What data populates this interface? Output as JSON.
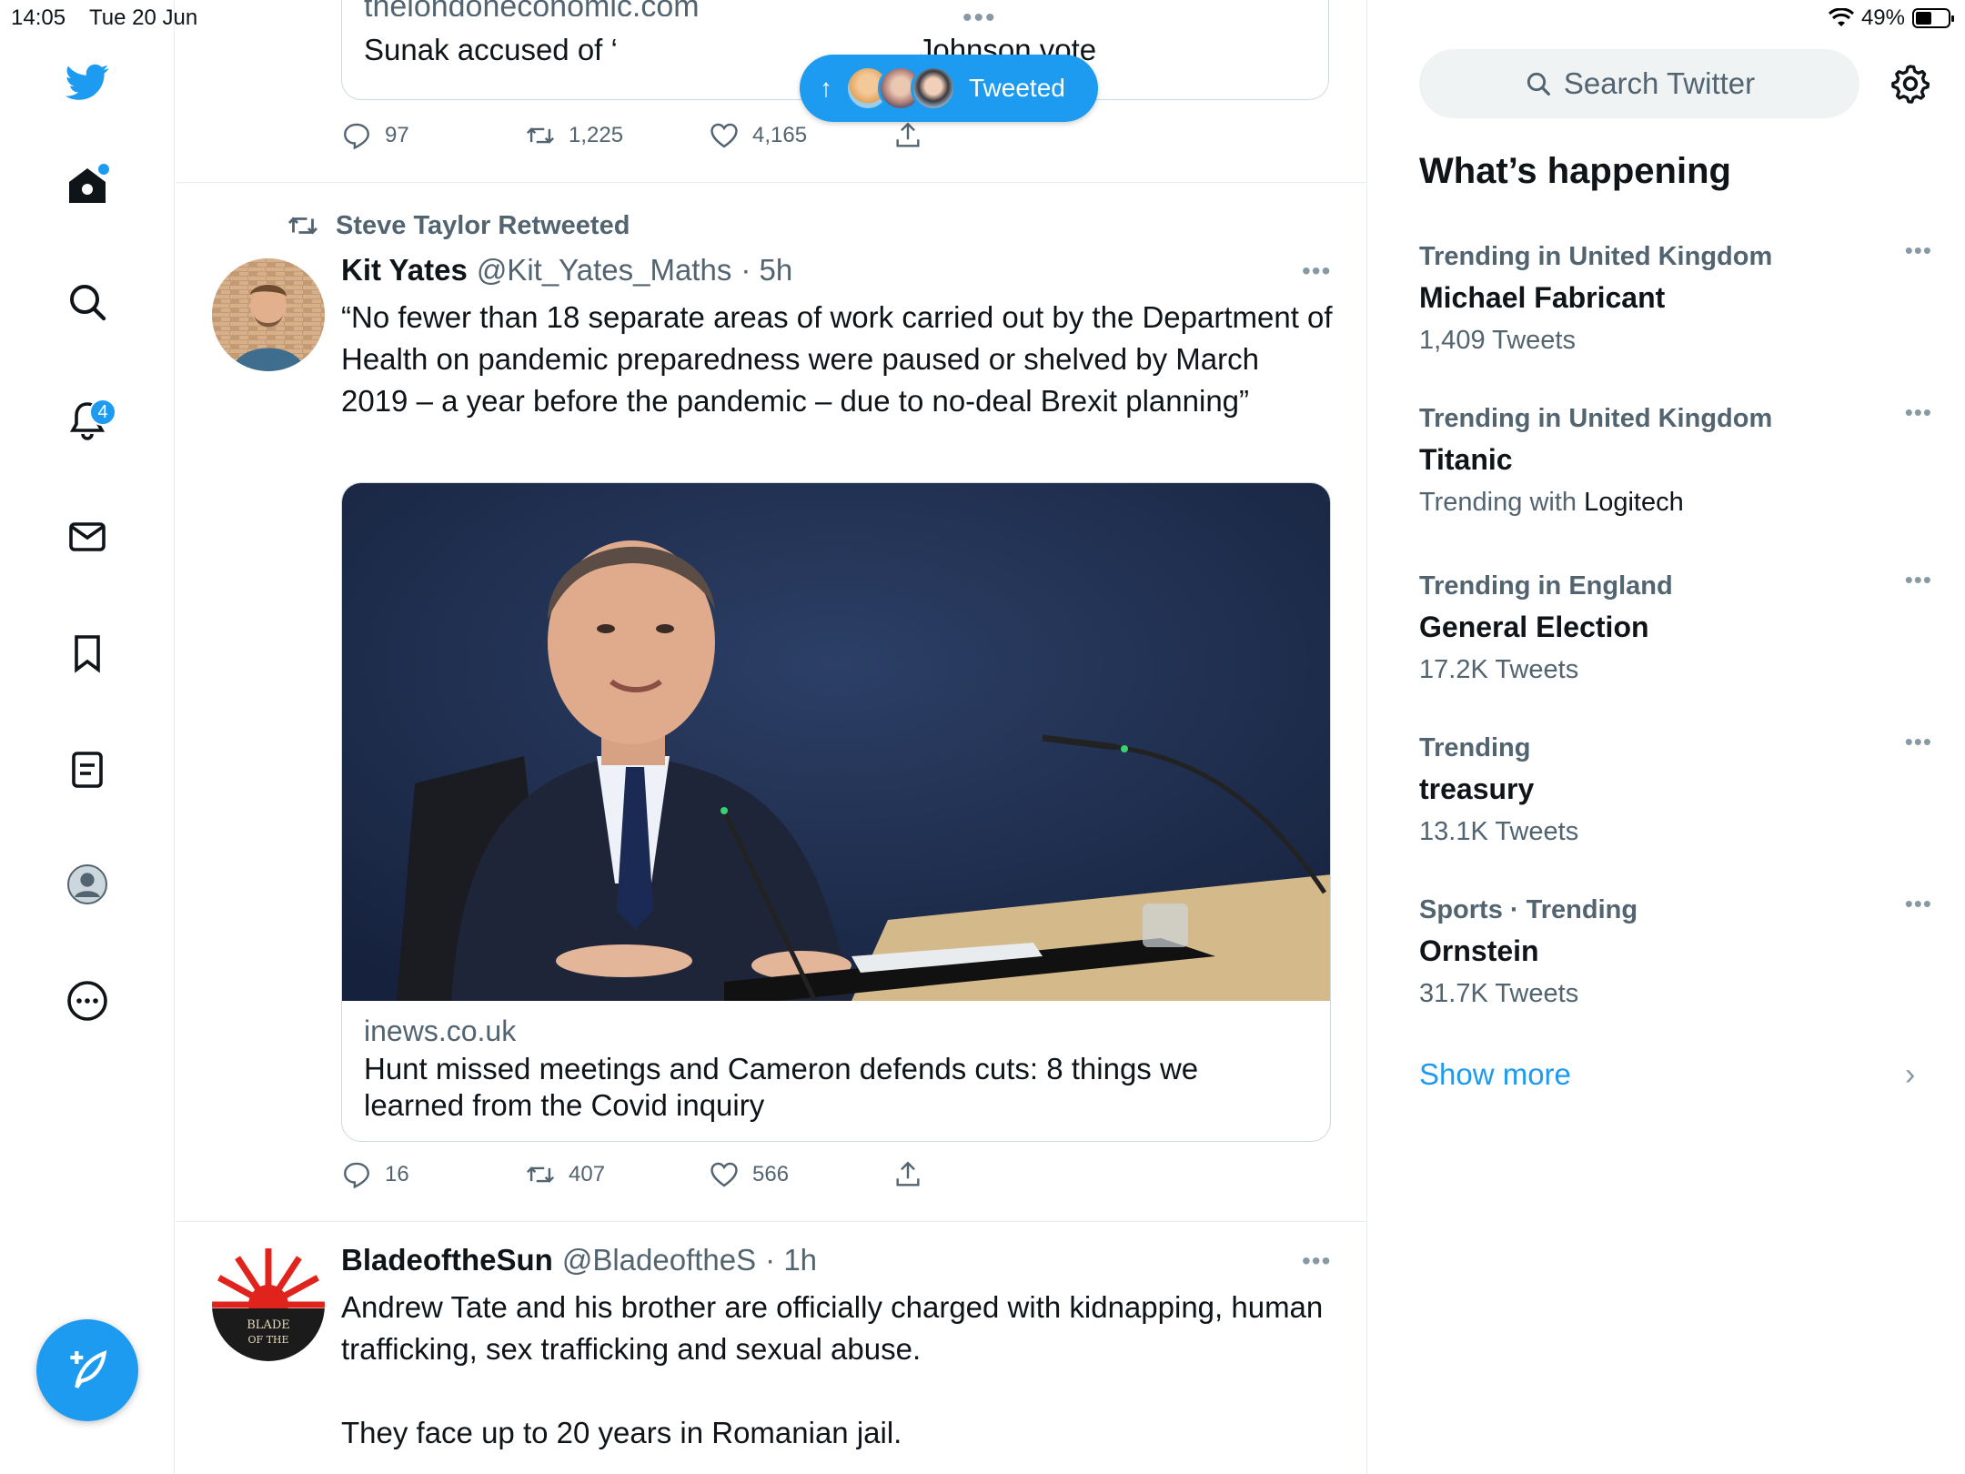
{
  "status": {
    "time": "14:05",
    "date": "Tue 20 Jun",
    "battery": "49%",
    "battery_level": 0.49
  },
  "nav": {
    "notifications_badge": "4"
  },
  "top_tweet": {
    "faded_link": "thelondoneconomic.com",
    "card_title": "Sunak accused of ‘ ... ’ Johnson vote",
    "title_left": "Sunak accused of ‘",
    "title_right": "Johnson vote",
    "replies": "97",
    "retweets": "1,225",
    "likes": "4,165"
  },
  "new_tweets_pill": {
    "arrow": "↑",
    "label": "Tweeted"
  },
  "tweet1": {
    "retweeted_by": "Steve Taylor Retweeted",
    "name": "Kit Yates",
    "handle": "@Kit_Yates_Maths",
    "time": "· 5h",
    "text": "“No fewer than 18 separate areas of work carried out by the Department of Health on pandemic preparedness were paused or shelved by March 2019 – a year before the pandemic – due to no-deal Brexit planning”",
    "card_domain": "inews.co.uk",
    "card_headline": "Hunt missed meetings and Cameron defends cuts: 8 things we learned from the Covid inquiry",
    "replies": "16",
    "retweets": "407",
    "likes": "566"
  },
  "tweet2": {
    "name": "BladeoftheSun",
    "handle": "@BladeoftheS",
    "time": "· 1h",
    "text_line1": "Andrew Tate and his brother are officially charged with kidnapping, human trafficking, sex trafficking and sexual abuse.",
    "text_line2": "They face up to 20 years in Romanian jail.",
    "avatar_text": "BLADE OF THE SUN"
  },
  "right": {
    "search_placeholder": "Search Twitter",
    "heading": "What’s happening",
    "trends": [
      {
        "context": "Trending in United Kingdom",
        "topic": "Michael Fabricant",
        "meta": "1,409 Tweets"
      },
      {
        "context": "Trending in United Kingdom",
        "topic": "Titanic",
        "meta_prefix": "Trending with",
        "meta_link": "Logitech"
      },
      {
        "context": "Trending in England",
        "topic": "General Election",
        "meta": "17.2K Tweets"
      },
      {
        "context": "Trending",
        "topic": "treasury",
        "meta": "13.1K Tweets"
      },
      {
        "context": "Sports · Trending",
        "topic": "Ornstein",
        "meta": "31.7K Tweets"
      }
    ],
    "show_more": "Show more"
  },
  "colors": {
    "accent": "#1d9bf0",
    "text": "#0f1419",
    "muted": "#536471"
  },
  "icons": [
    "twitter-logo-icon",
    "home-icon",
    "search-icon",
    "bell-icon",
    "mail-icon",
    "bookmark-icon",
    "list-icon",
    "profile-icon",
    "more-circle-icon",
    "compose-icon",
    "reply-icon",
    "retweet-icon",
    "like-icon",
    "share-icon",
    "gear-icon",
    "wifi-icon",
    "battery-icon"
  ]
}
